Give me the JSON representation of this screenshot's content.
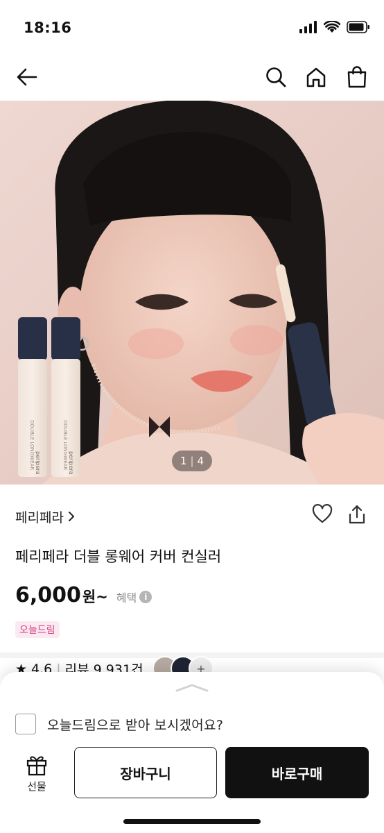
{
  "status_bar": {
    "time": "18:16",
    "icons": [
      "signal-icon",
      "wifi-icon",
      "battery-icon"
    ]
  },
  "nav": {
    "icons": [
      "back-arrow-icon",
      "search-icon",
      "home-icon",
      "shopping-bag-icon"
    ]
  },
  "hero": {
    "image": "model-with-concealer-photo",
    "page_current": "1",
    "page_separator": "|",
    "page_total": "4",
    "product_brand_print": "peripera",
    "product_print": "DOUBLE LONGWEAR"
  },
  "product": {
    "brand": "페리페라",
    "title": "페리페라 더블 롱웨어 커버 컨실러",
    "price": "6,000",
    "price_unit": "원~",
    "benefit_label": "혜택",
    "info_icon_text": "i",
    "badge": "오늘드림",
    "rating": "4.6",
    "review_label": "리뷰 9,931건",
    "more_avatars": "+"
  },
  "sheet": {
    "dream_checkbox_label": "오늘드림으로 받아 보시겠어요?",
    "dream_checked": false,
    "gift_label": "선물",
    "cart_label": "장바구니",
    "buy_label": "바로구매"
  },
  "colors": {
    "accent_pink": "#d63e83",
    "badge_bg": "#fbe9f1",
    "buy_button": "#111111",
    "text_primary": "#111111",
    "text_muted": "#8a8a8a"
  }
}
